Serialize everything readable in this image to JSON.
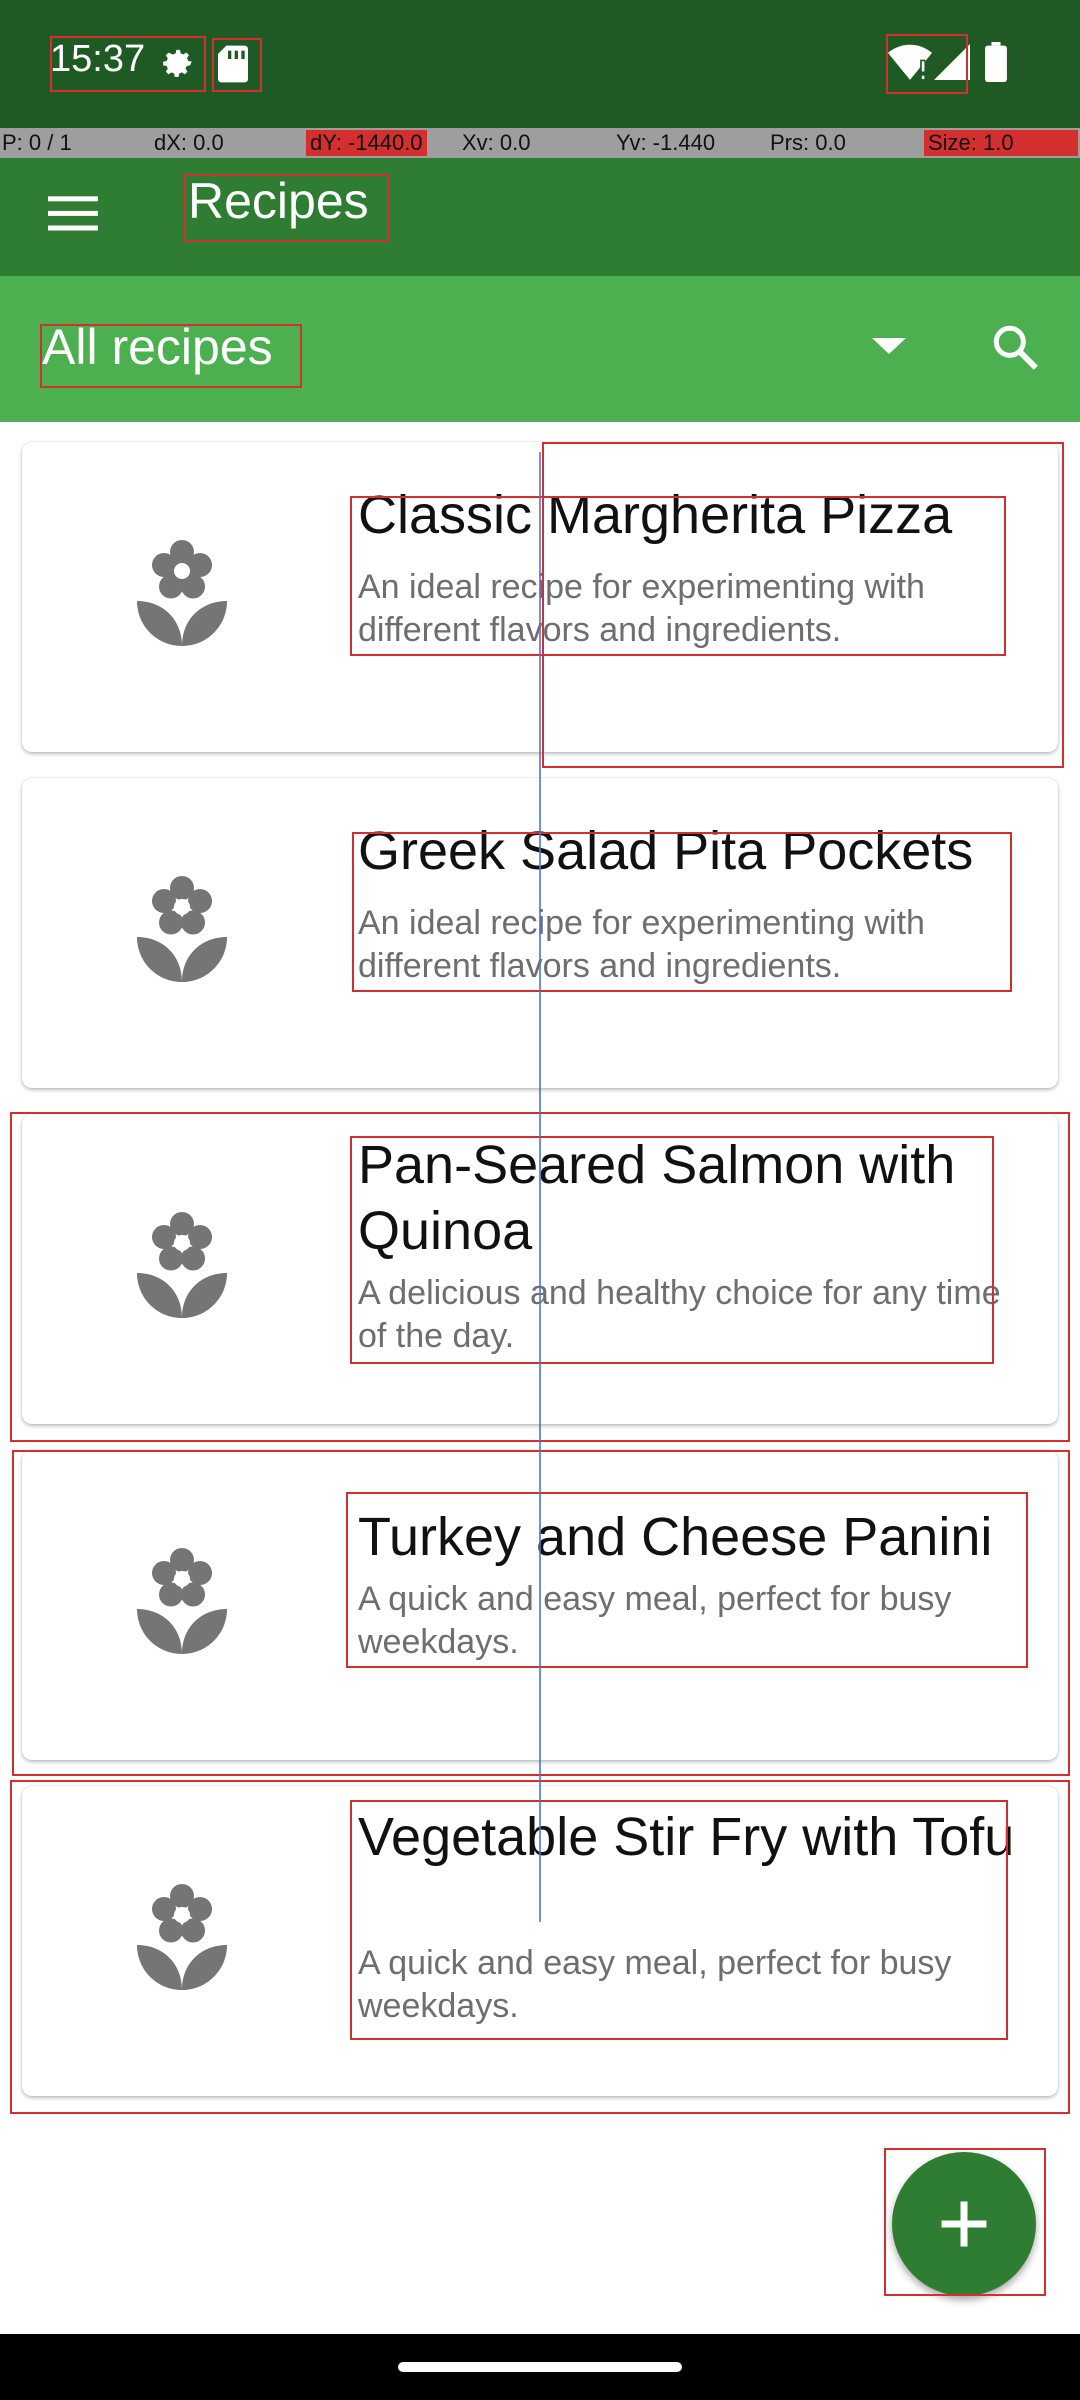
{
  "status_bar": {
    "time": "15:37"
  },
  "debug_bar": {
    "p": "P: 0 / 1",
    "dx": "dX: 0.0",
    "dy": "dY: -1440.0",
    "xv": "Xv: 0.0",
    "yv": "Yv: -1.440",
    "prs": "Prs: 0.0",
    "size": "Size: 1.0"
  },
  "toolbar": {
    "title": "Recipes"
  },
  "filter": {
    "selected": "All recipes"
  },
  "recipes": [
    {
      "title": "Classic Margherita Pizza",
      "description": "An ideal recipe for experimenting with different flavors and ingredients."
    },
    {
      "title": "Greek Salad Pita Pockets",
      "description": "An ideal recipe for experimenting with different flavors and ingredients."
    },
    {
      "title": "Pan-Seared Salmon with Quinoa",
      "description": "A delicious and healthy choice for any time of the day."
    },
    {
      "title": "Turkey and Cheese Panini",
      "description": "A quick and easy meal, perfect for busy weekdays."
    },
    {
      "title": "Vegetable Stir Fry with Tofu",
      "description": "A quick and easy meal, perfect for busy weekdays."
    }
  ],
  "icons": {
    "menu": "menu-icon",
    "search": "search-icon",
    "dropdown": "dropdown-arrow-icon",
    "recipe": "flower-icon",
    "add": "plus-icon"
  },
  "colors": {
    "status_bar": "#1f5a24",
    "toolbar": "#2e7d32",
    "filter_bar": "#4caf50",
    "fab": "#2e7d32"
  }
}
